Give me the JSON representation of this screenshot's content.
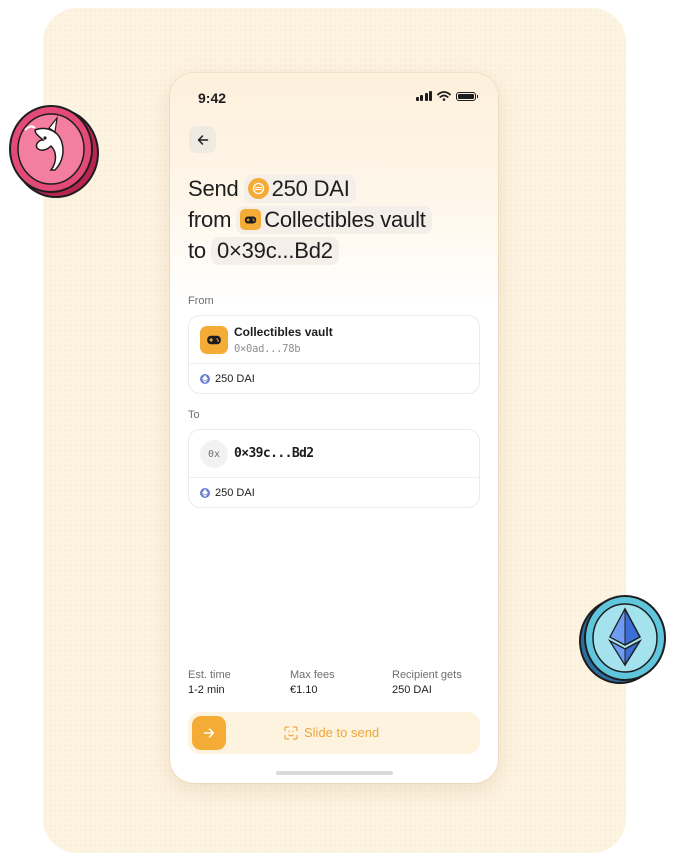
{
  "status_bar": {
    "time": "9:42"
  },
  "headline": {
    "send_word": "Send",
    "amount": "250 DAI",
    "from_word": "from",
    "vault_name": "Collectibles vault",
    "to_word": "to",
    "recipient": "0×39c...Bd2"
  },
  "from_section": {
    "label": "From",
    "account_name": "Collectibles vault",
    "account_address": "0×0ad...78b",
    "amount": "250 DAI"
  },
  "to_section": {
    "label": "To",
    "avatar_text": "0x",
    "address": "0×39c...Bd2",
    "amount": "250 DAI"
  },
  "stats": [
    {
      "label": "Est. time",
      "value": "1-2 min"
    },
    {
      "label": "Max fees",
      "value": "€1.10"
    },
    {
      "label": "Recipient gets",
      "value": "250 DAI"
    }
  ],
  "slider": {
    "label": "Slide to send"
  },
  "colors": {
    "accent": "#f5ac37",
    "accent_light": "#fef3de",
    "backdrop": "#fdf3e1",
    "uniswap_pink": "#e44a78",
    "ethereum_blue": "#5fc6dc"
  },
  "icons": {
    "back": "arrow-left-icon",
    "dai": "dai-coin-icon",
    "vault": "gamepad-icon",
    "eth": "ethereum-icon",
    "slider_knob": "arrow-right-icon",
    "slider_label": "face-id-icon",
    "decor_left": "uniswap-coin-icon",
    "decor_right": "ethereum-coin-icon"
  }
}
